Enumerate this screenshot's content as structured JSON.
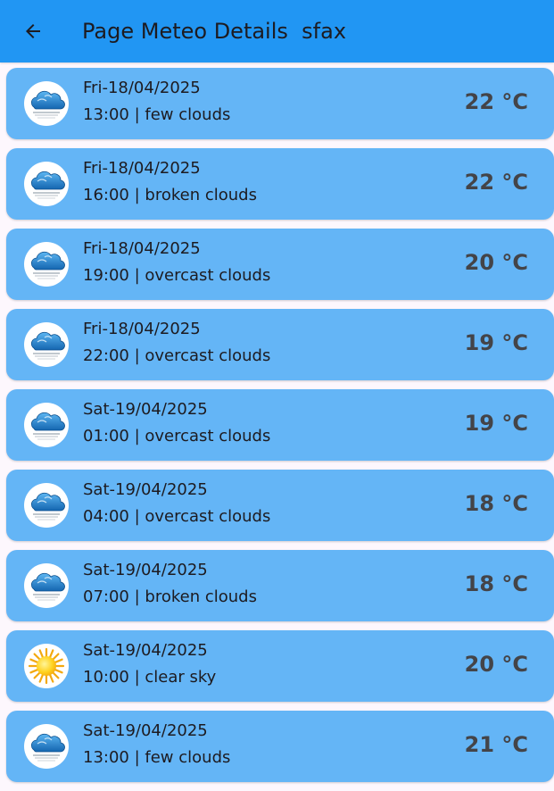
{
  "header": {
    "title": "Page Meteo Details  sfax"
  },
  "forecasts": [
    {
      "date": "Fri-18/04/2025",
      "time": "13:00",
      "description": "few clouds",
      "temp": "22 °C",
      "icon": "cloud-icon"
    },
    {
      "date": "Fri-18/04/2025",
      "time": "16:00",
      "description": "broken clouds",
      "temp": "22 °C",
      "icon": "cloud-icon"
    },
    {
      "date": "Fri-18/04/2025",
      "time": "19:00",
      "description": "overcast clouds",
      "temp": "20 °C",
      "icon": "cloud-icon"
    },
    {
      "date": "Fri-18/04/2025",
      "time": "22:00",
      "description": "overcast clouds",
      "temp": "19 °C",
      "icon": "cloud-icon"
    },
    {
      "date": "Sat-19/04/2025",
      "time": "01:00",
      "description": "overcast clouds",
      "temp": "19 °C",
      "icon": "cloud-icon"
    },
    {
      "date": "Sat-19/04/2025",
      "time": "04:00",
      "description": "overcast clouds",
      "temp": "18 °C",
      "icon": "cloud-icon"
    },
    {
      "date": "Sat-19/04/2025",
      "time": "07:00",
      "description": "broken clouds",
      "temp": "18 °C",
      "icon": "cloud-icon"
    },
    {
      "date": "Sat-19/04/2025",
      "time": "10:00",
      "description": "clear sky",
      "temp": "20 °C",
      "icon": "sun-icon"
    },
    {
      "date": "Sat-19/04/2025",
      "time": "13:00",
      "description": "few clouds",
      "temp": "21 °C",
      "icon": "cloud-icon"
    }
  ],
  "colors": {
    "appbar": "#2196f3",
    "card": "#64b5f6",
    "background": "#fdf7fd",
    "text": "#1d1b20",
    "temperature": "#444448"
  }
}
